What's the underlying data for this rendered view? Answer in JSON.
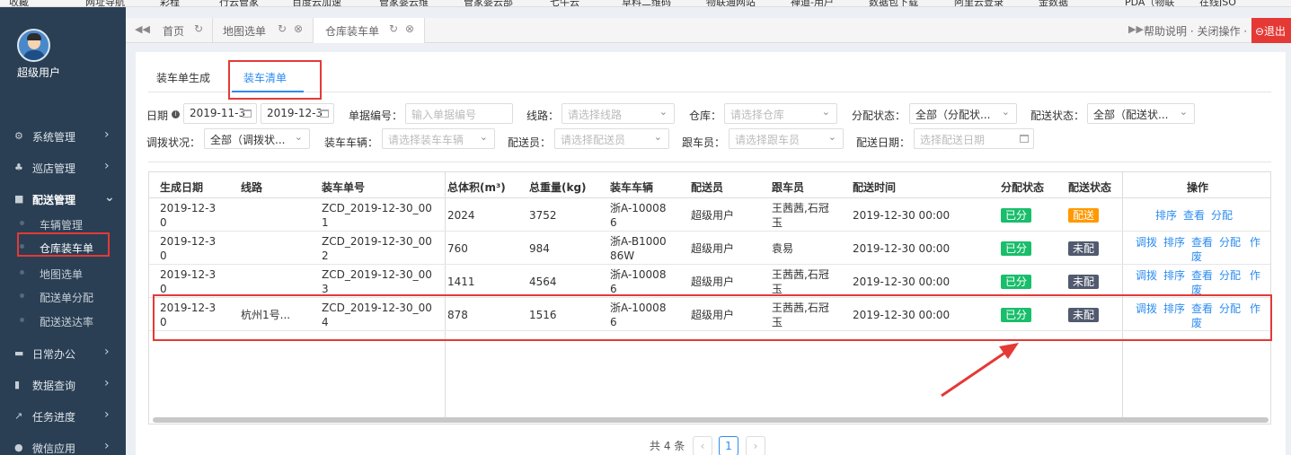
{
  "bookmarks": [
    "收藏",
    "网址导航",
    "彩程",
    "行云管家",
    "百度云加速",
    "管家婆云维",
    "管家婆云部",
    "七牛云",
    "草料二维码",
    "物联通网站",
    "禅道-用户",
    "数据包下载",
    "阿里云登录",
    "金数据",
    "PDA（物联",
    "在线JSO"
  ],
  "sidebar": {
    "user_name": "超级用户",
    "items": [
      {
        "label": "系统管理",
        "icon": "⚙",
        "chevron": "›"
      },
      {
        "label": "巡店管理",
        "icon": "♣",
        "chevron": "›"
      },
      {
        "label": "配送管理",
        "icon": "■",
        "chevron": "⌄"
      },
      {
        "label": "日常办公",
        "icon": "▬",
        "chevron": "›"
      },
      {
        "label": "数据查询",
        "icon": "▮",
        "chevron": "›"
      },
      {
        "label": "任务进度",
        "icon": "↗",
        "chevron": "›"
      },
      {
        "label": "微信应用",
        "icon": "●",
        "chevron": "›"
      }
    ],
    "sub_items": [
      "车辆管理",
      "仓库装车单",
      "地图选单",
      "配送单分配",
      "配送送达率"
    ]
  },
  "tabbar": {
    "back": "◀◀",
    "forward": "▶▶",
    "tabs": [
      "首页",
      "地图选单",
      "仓库装车单"
    ],
    "refresh_icon": "↻",
    "close_icon": "⊗",
    "help": "帮助说明 · 关闭操作 ·",
    "logout": "⊖退出"
  },
  "subtabs": [
    "装车单生成",
    "装车清单"
  ],
  "filters": {
    "date_label": "日期",
    "date_from": "2019-11-3",
    "date_to": "2019-12-3",
    "bill_no_label": "单据编号：",
    "bill_no_placeholder": "输入单据编号",
    "route_label": "线路：",
    "route_placeholder": "请选择线路",
    "warehouse_label": "仓库：",
    "warehouse_placeholder": "请选择仓库",
    "assign_label": "分配状态：",
    "assign_value": "全部（分配状...",
    "delivery_status_label": "配送状态：",
    "delivery_status_value": "全部（配送状...",
    "transfer_label": "调拨状况：",
    "transfer_value": "全部（调拨状...",
    "vehicle_label": "装车车辆：",
    "vehicle_placeholder": "请选择装车车辆",
    "deliverer_label": "配送员：",
    "deliverer_placeholder": "请选择配送员",
    "follower_label": "跟车员：",
    "follower_placeholder": "请选择跟车员",
    "delivery_date_label": "配送日期：",
    "delivery_date_placeholder": "选择配送日期"
  },
  "table": {
    "headers": [
      "生成日期",
      "线路",
      "装车单号",
      "总体积(m³)",
      "总重量(kg)",
      "装车车辆",
      "配送员",
      "跟车员",
      "配送时间",
      "分配状态",
      "配送状态",
      "操作"
    ],
    "rows": [
      {
        "date1": "2019-12-3",
        "date2": "0",
        "route": "",
        "no1": "ZCD_2019-12-30_00",
        "no2": "1",
        "volume": "2024",
        "weight": "3752",
        "veh1": "浙A-10008",
        "veh2": "6",
        "deliverer": "超级用户",
        "fol1": "王茜茜,石冠",
        "fol2": "玉",
        "time": "2019-12-30 00:00",
        "assign": "已分",
        "status": "配送",
        "status_color": "orange",
        "ops1": [
          "排序",
          "查看",
          "分配"
        ],
        "ops2": []
      },
      {
        "date1": "2019-12-3",
        "date2": "0",
        "route": "",
        "no1": "ZCD_2019-12-30_00",
        "no2": "2",
        "volume": "760",
        "weight": "984",
        "veh1": "浙A-B1000",
        "veh2": "86W",
        "deliverer": "超级用户",
        "fol1": "袁易",
        "fol2": "",
        "time": "2019-12-30 00:00",
        "assign": "已分",
        "status": "未配",
        "status_color": "dark",
        "ops1": [
          "调拨",
          "排序",
          "查看",
          "分配",
          "作"
        ],
        "ops2": [
          "废"
        ]
      },
      {
        "date1": "2019-12-3",
        "date2": "0",
        "route": "",
        "no1": "ZCD_2019-12-30_00",
        "no2": "3",
        "volume": "1411",
        "weight": "4564",
        "veh1": "浙A-10008",
        "veh2": "6",
        "deliverer": "超级用户",
        "fol1": "王茜茜,石冠",
        "fol2": "玉",
        "time": "2019-12-30 00:00",
        "assign": "已分",
        "status": "未配",
        "status_color": "dark",
        "ops1": [
          "调拨",
          "排序",
          "查看",
          "分配",
          "作"
        ],
        "ops2": [
          "废"
        ]
      },
      {
        "date1": "2019-12-3",
        "date2": "0",
        "route": "杭州1号...",
        "no1": "ZCD_2019-12-30_00",
        "no2": "4",
        "volume": "878",
        "weight": "1516",
        "veh1": "浙A-10008",
        "veh2": "6",
        "deliverer": "超级用户",
        "fol1": "王茜茜,石冠",
        "fol2": "玉",
        "time": "2019-12-30 00:00",
        "assign": "已分",
        "status": "未配",
        "status_color": "dark",
        "ops1": [
          "调拨",
          "排序",
          "查看",
          "分配",
          "作"
        ],
        "ops2": [
          "废"
        ]
      }
    ]
  },
  "pager": {
    "total": "共 4 条",
    "prev": "‹",
    "current": "1",
    "next": "›"
  },
  "colors": {
    "sidebar": "#2a3f54",
    "accent": "#2d8cf0",
    "highlight": "#e53935",
    "assigned": "#19be6b",
    "delivering": "#ff9900",
    "unassigned": "#515a6e"
  }
}
